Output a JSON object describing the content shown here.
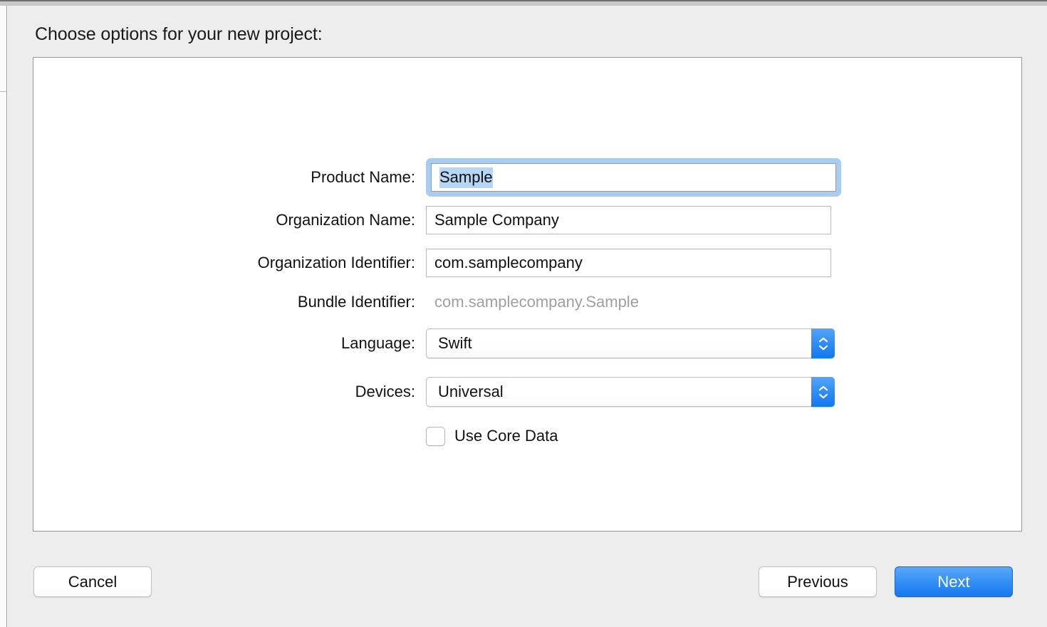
{
  "window": {
    "dialog_title": "Choose options for your new project:"
  },
  "form": {
    "fields": [
      {
        "label": "Product Name:",
        "value": "Sample",
        "type": "text",
        "focused": true,
        "selected": true
      },
      {
        "label": "Organization Name:",
        "value": "Sample Company",
        "type": "text",
        "focused": false,
        "selected": false
      },
      {
        "label": "Organization Identifier:",
        "value": "com.samplecompany",
        "type": "text",
        "focused": false,
        "selected": false
      },
      {
        "label": "Bundle Identifier:",
        "value": "com.samplecompany.Sample",
        "type": "static",
        "focused": false,
        "selected": false
      },
      {
        "label": "Language:",
        "value": "Swift",
        "type": "popup",
        "focused": false,
        "selected": false
      },
      {
        "label": "Devices:",
        "value": "Universal",
        "type": "popup",
        "focused": false,
        "selected": false
      }
    ],
    "checkbox": {
      "label": "Use Core Data",
      "checked": false
    }
  },
  "buttons": {
    "cancel": "Cancel",
    "previous": "Previous",
    "next": "Next"
  },
  "colors": {
    "accent_blue": "#2f8df4",
    "default_button_top": "#5aa9f8",
    "default_button_bottom": "#1678ef",
    "focus_ring": "#a9cdf0",
    "selection_highlight": "#b6d6f6",
    "dialog_background": "#ededed",
    "panel_background": "#ffffff",
    "panel_border": "#969696",
    "disabled_text": "#a0a0a0"
  }
}
